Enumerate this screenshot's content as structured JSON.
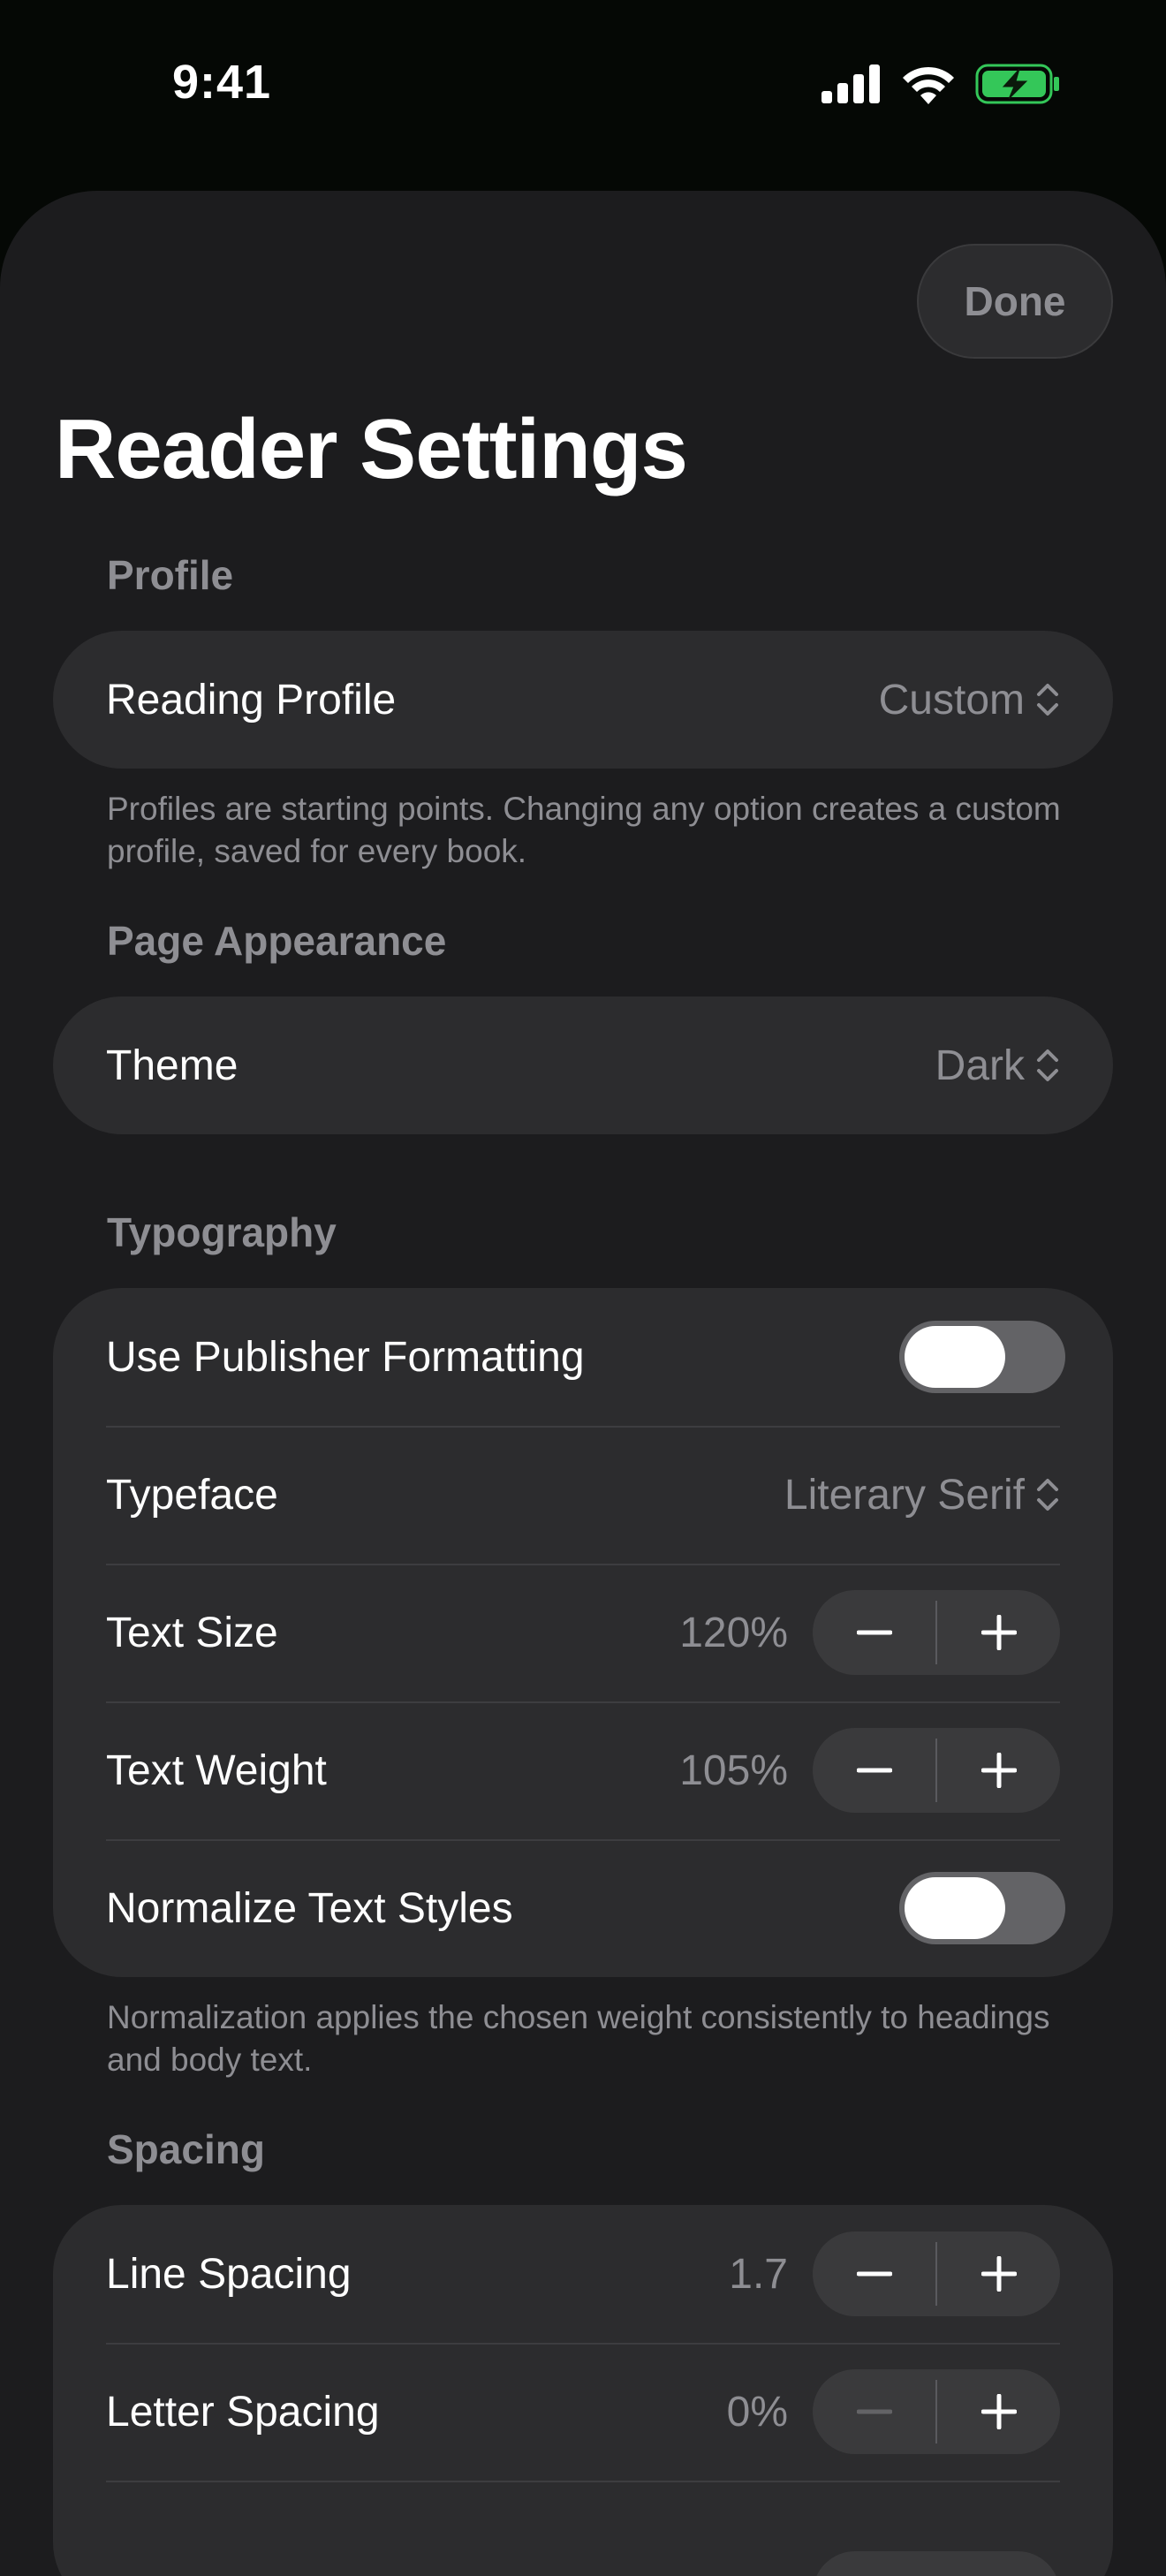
{
  "status": {
    "time": "9:41"
  },
  "header": {
    "done_label": "Done",
    "title": "Reader Settings"
  },
  "profile": {
    "header": "Profile",
    "reading_profile_label": "Reading Profile",
    "reading_profile_value": "Custom",
    "footnote": "Profiles are starting points. Changing any option creates a custom profile, saved for every book."
  },
  "appearance": {
    "header": "Page Appearance",
    "theme_label": "Theme",
    "theme_value": "Dark"
  },
  "typography": {
    "header": "Typography",
    "publisher_formatting_label": "Use Publisher Formatting",
    "publisher_formatting_on": false,
    "typeface_label": "Typeface",
    "typeface_value": "Literary Serif",
    "text_size_label": "Text Size",
    "text_size_value": "120%",
    "text_weight_label": "Text Weight",
    "text_weight_value": "105%",
    "normalize_label": "Normalize Text Styles",
    "normalize_on": false,
    "footnote": "Normalization applies the chosen weight consistently to headings and body text."
  },
  "spacing": {
    "header": "Spacing",
    "line_spacing_label": "Line Spacing",
    "line_spacing_value": "1.7",
    "letter_spacing_label": "Letter Spacing",
    "letter_spacing_value": "0%"
  },
  "colors": {
    "sheet_bg": "#1c1c1e",
    "group_bg": "#2c2c2e",
    "secondary_text": "#8e8e93",
    "battery_green": "#34c759"
  }
}
